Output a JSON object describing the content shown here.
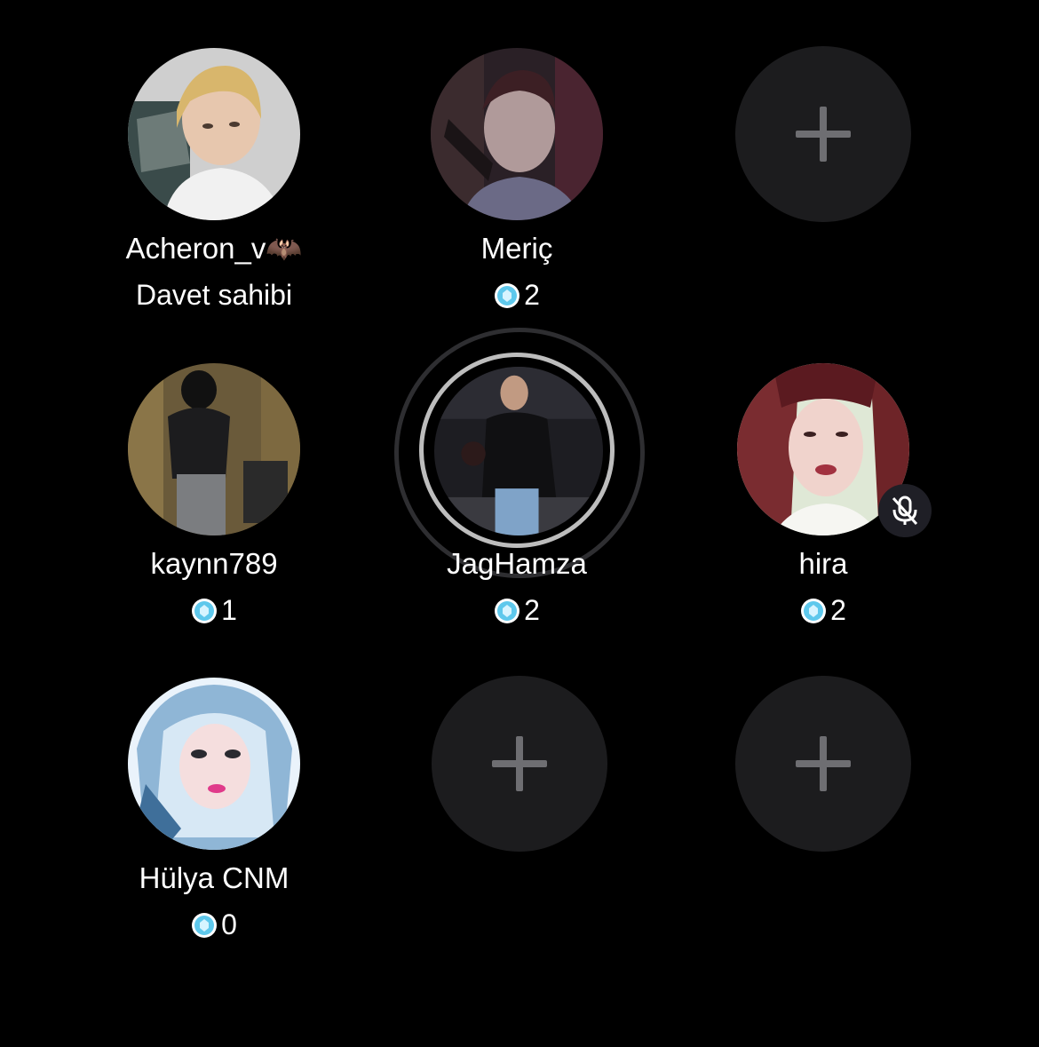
{
  "seats": [
    {
      "name": "Acheron_v",
      "name_emoji": "🦇",
      "subtitle": "Davet sahibi",
      "role": "host"
    },
    {
      "name": "Meriç",
      "gem_count": "2"
    },
    {
      "empty_icon": "plus-icon"
    },
    {
      "name": "kaynn789",
      "gem_count": "1"
    },
    {
      "name": "JagHamza",
      "gem_count": "2",
      "speaking": true
    },
    {
      "name": "hira",
      "gem_count": "2",
      "muted": true,
      "muted_icon": "mic-off-icon"
    },
    {
      "name": "Hülya CNM",
      "gem_count": "0"
    },
    {
      "empty_icon": "plus-icon"
    },
    {
      "empty_icon": "plus-icon"
    }
  ],
  "icons": {
    "gem": "diamond-gem-icon",
    "empty_seat": "plus-icon",
    "mute": "mic-off-icon"
  },
  "colors": {
    "background": "#000000",
    "empty_seat": "#1c1c1e",
    "plus": "#6e6e72",
    "gem": "#5ec8ec",
    "text": "#ffffff"
  }
}
